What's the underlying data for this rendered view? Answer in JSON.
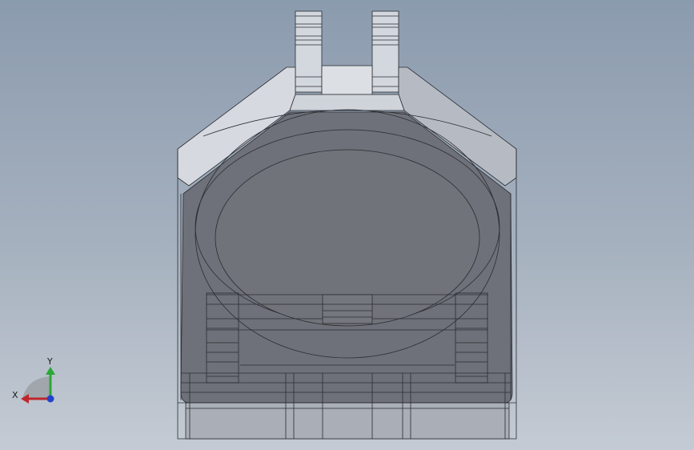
{
  "view": {
    "background_top": "#8b9bae",
    "background_bottom": "#c4cbd4",
    "model_color": "#6e7179",
    "edge_color": "#2a2c30"
  },
  "triad": {
    "x_label": "X",
    "y_label": "Y",
    "x_color": "#c0262b",
    "y_color": "#2aa838",
    "z_color": "#2442c8"
  }
}
